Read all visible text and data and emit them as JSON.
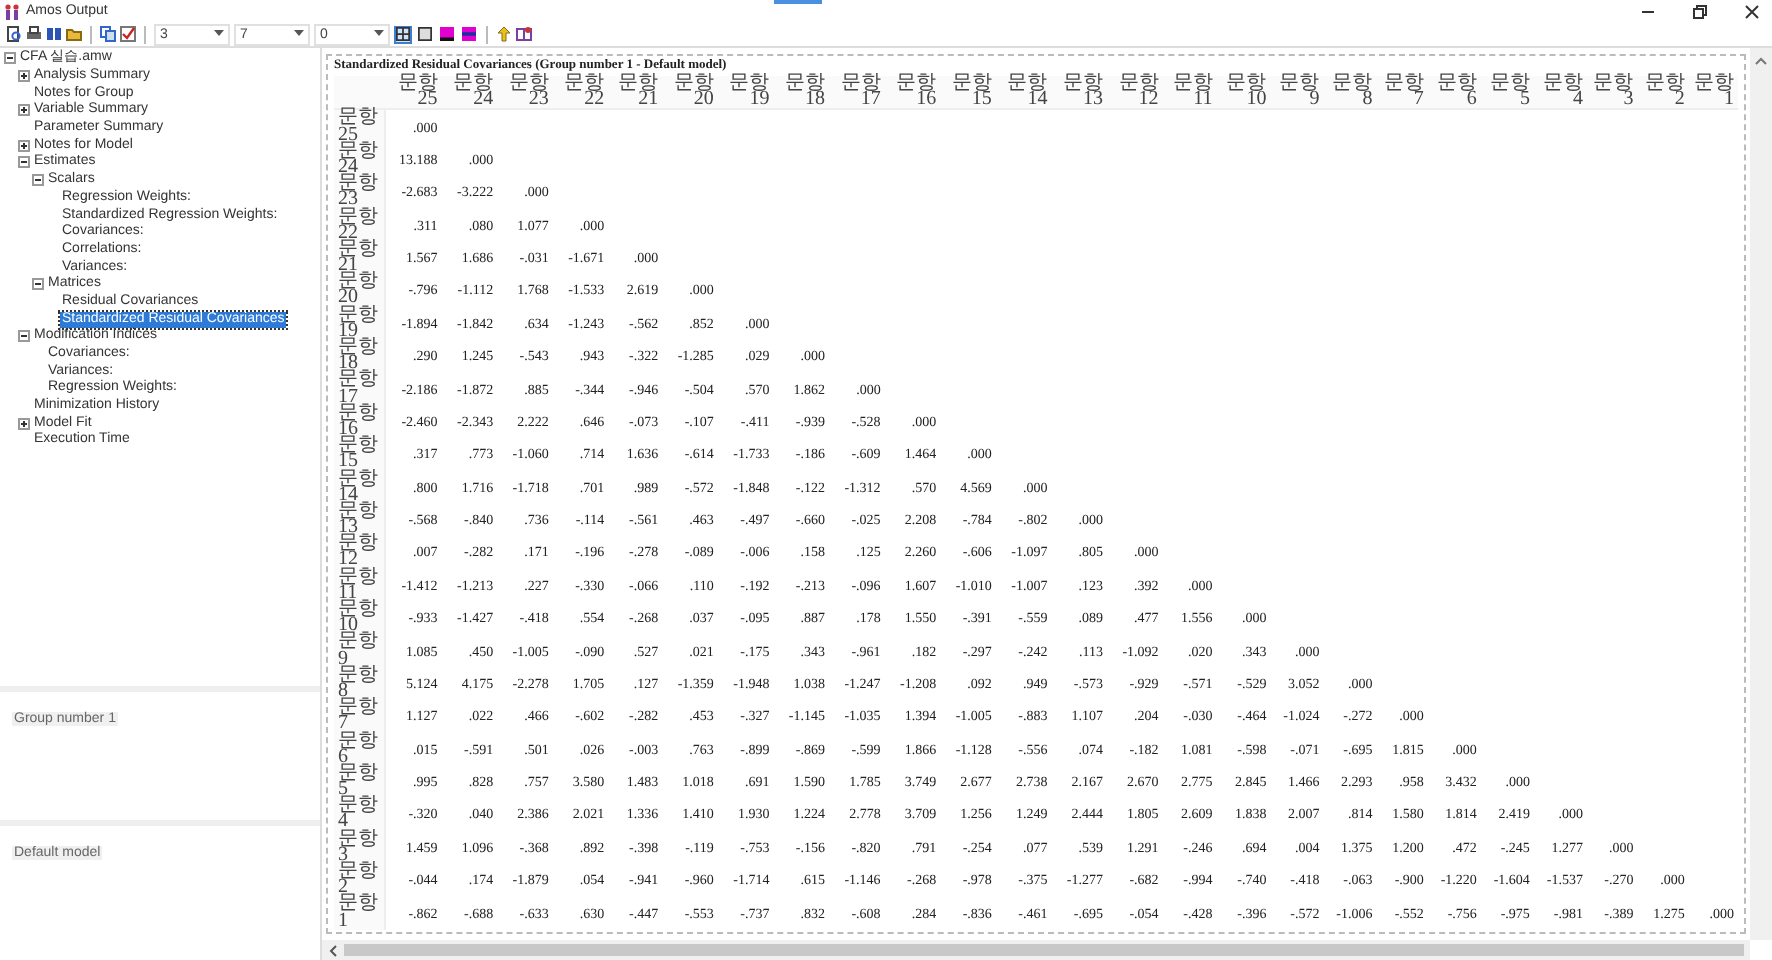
{
  "window": {
    "title": "Amos Output"
  },
  "toolbar": {
    "selectors": [
      {
        "value": "3"
      },
      {
        "value": "7"
      },
      {
        "value": "0"
      }
    ],
    "toggles": [
      {
        "kind": "grid",
        "selected": true
      },
      {
        "kind": "plain",
        "selected": false
      },
      {
        "kind": "magenta",
        "selected": false
      },
      {
        "kind": "magenta-blue",
        "selected": false
      }
    ]
  },
  "tree": {
    "items": [
      {
        "label": "CFA 실습.amw",
        "expanded": true,
        "selected": false,
        "children": [
          {
            "label": "Analysis Summary",
            "expanded": false,
            "selected": false
          },
          {
            "label": "Notes for Group",
            "selected": false
          },
          {
            "label": "Variable Summary",
            "expanded": false,
            "selected": false
          },
          {
            "label": "Parameter Summary",
            "selected": false
          },
          {
            "label": "Notes for Model",
            "expanded": false,
            "selected": false
          },
          {
            "label": "Estimates",
            "expanded": true,
            "selected": false,
            "children": [
              {
                "label": "Scalars",
                "expanded": true,
                "selected": false,
                "children": [
                  {
                    "label": "Regression Weights:",
                    "selected": false
                  },
                  {
                    "label": "Standardized Regression Weights:",
                    "selected": false
                  },
                  {
                    "label": "Covariances:",
                    "selected": false
                  },
                  {
                    "label": "Correlations:",
                    "selected": false
                  },
                  {
                    "label": "Variances:",
                    "selected": false
                  }
                ]
              },
              {
                "label": "Matrices",
                "expanded": true,
                "selected": false,
                "children": [
                  {
                    "label": "Residual Covariances",
                    "selected": false
                  },
                  {
                    "label": "Standardized Residual Covariances",
                    "selected": true
                  }
                ]
              }
            ]
          },
          {
            "label": "Modification Indices",
            "expanded": true,
            "selected": false,
            "children": [
              {
                "label": "Covariances:",
                "selected": false
              },
              {
                "label": "Variances:",
                "selected": false
              },
              {
                "label": "Regression Weights:",
                "selected": false
              }
            ]
          },
          {
            "label": "Minimization History",
            "selected": false
          },
          {
            "label": "Model Fit",
            "expanded": false,
            "selected": false
          },
          {
            "label": "Execution Time",
            "selected": false
          }
        ]
      }
    ]
  },
  "groups": {
    "items": [
      "Group number 1"
    ]
  },
  "models": {
    "items": [
      "Default model"
    ]
  },
  "output": {
    "title": "Standardized Residual Covariances (Group number 1 - Default model)",
    "columns": [
      "문항25",
      "문항24",
      "문항23",
      "문항22",
      "문항21",
      "문항20",
      "문항19",
      "문항18",
      "문항17",
      "문항16",
      "문항15",
      "문항14",
      "문항13",
      "문항12",
      "문항11",
      "문항10",
      "문항9",
      "문항8",
      "문항7",
      "문항6",
      "문항5",
      "문항4",
      "문항3",
      "문항2",
      "문항1"
    ],
    "rows": [
      {
        "label": "문항25",
        "values": [
          ".000"
        ]
      },
      {
        "label": "문항24",
        "values": [
          "13.188",
          ".000"
        ]
      },
      {
        "label": "문항23",
        "values": [
          "-2.683",
          "-3.222",
          ".000"
        ]
      },
      {
        "label": "문항22",
        "values": [
          ".311",
          ".080",
          "1.077",
          ".000"
        ]
      },
      {
        "label": "문항21",
        "values": [
          "1.567",
          "1.686",
          "-.031",
          "-1.671",
          ".000"
        ]
      },
      {
        "label": "문항20",
        "values": [
          "-.796",
          "-1.112",
          "1.768",
          "-1.533",
          "2.619",
          ".000"
        ]
      },
      {
        "label": "문항19",
        "values": [
          "-1.894",
          "-1.842",
          ".634",
          "-1.243",
          "-.562",
          ".852",
          ".000"
        ]
      },
      {
        "label": "문항18",
        "values": [
          ".290",
          "1.245",
          "-.543",
          ".943",
          "-.322",
          "-1.285",
          ".029",
          ".000"
        ]
      },
      {
        "label": "문항17",
        "values": [
          "-2.186",
          "-1.872",
          ".885",
          "-.344",
          "-.946",
          "-.504",
          ".570",
          "1.862",
          ".000"
        ]
      },
      {
        "label": "문항16",
        "values": [
          "-2.460",
          "-2.343",
          "2.222",
          ".646",
          "-.073",
          "-.107",
          "-.411",
          "-.939",
          "-.528",
          ".000"
        ]
      },
      {
        "label": "문항15",
        "values": [
          ".317",
          ".773",
          "-1.060",
          ".714",
          "1.636",
          "-.614",
          "-1.733",
          "-.186",
          "-.609",
          "1.464",
          ".000"
        ]
      },
      {
        "label": "문항14",
        "values": [
          ".800",
          "1.716",
          "-1.718",
          ".701",
          ".989",
          "-.572",
          "-1.848",
          "-.122",
          "-1.312",
          ".570",
          "4.569",
          ".000"
        ]
      },
      {
        "label": "문항13",
        "values": [
          "-.568",
          "-.840",
          ".736",
          "-.114",
          "-.561",
          ".463",
          "-.497",
          "-.660",
          "-.025",
          "2.208",
          "-.784",
          "-.802",
          ".000"
        ]
      },
      {
        "label": "문항12",
        "values": [
          ".007",
          "-.282",
          ".171",
          "-.196",
          "-.278",
          "-.089",
          "-.006",
          ".158",
          ".125",
          "2.260",
          "-.606",
          "-1.097",
          ".805",
          ".000"
        ]
      },
      {
        "label": "문항11",
        "values": [
          "-1.412",
          "-1.213",
          ".227",
          "-.330",
          "-.066",
          ".110",
          "-.192",
          "-.213",
          "-.096",
          "1.607",
          "-1.010",
          "-1.007",
          ".123",
          ".392",
          ".000"
        ]
      },
      {
        "label": "문항10",
        "values": [
          "-.933",
          "-1.427",
          "-.418",
          ".554",
          "-.268",
          ".037",
          "-.095",
          ".887",
          ".178",
          "1.550",
          "-.391",
          "-.559",
          ".089",
          ".477",
          "1.556",
          ".000"
        ]
      },
      {
        "label": "문항9",
        "values": [
          "1.085",
          ".450",
          "-1.005",
          "-.090",
          ".527",
          ".021",
          "-.175",
          ".343",
          "-.961",
          ".182",
          "-.297",
          "-.242",
          ".113",
          "-1.092",
          ".020",
          ".343",
          ".000"
        ]
      },
      {
        "label": "문항8",
        "values": [
          "5.124",
          "4.175",
          "-2.278",
          "1.705",
          ".127",
          "-1.359",
          "-1.948",
          "1.038",
          "-1.247",
          "-1.208",
          ".092",
          ".949",
          "-.573",
          "-.929",
          "-.571",
          "-.529",
          "3.052",
          ".000"
        ]
      },
      {
        "label": "문항7",
        "values": [
          "1.127",
          ".022",
          ".466",
          "-.602",
          "-.282",
          ".453",
          "-.327",
          "-1.145",
          "-1.035",
          "1.394",
          "-1.005",
          "-.883",
          "1.107",
          ".204",
          "-.030",
          "-.464",
          "-1.024",
          "-.272",
          ".000"
        ]
      },
      {
        "label": "문항6",
        "values": [
          ".015",
          "-.591",
          ".501",
          ".026",
          "-.003",
          ".763",
          "-.899",
          "-.869",
          "-.599",
          "1.866",
          "-1.128",
          "-.556",
          ".074",
          "-.182",
          "1.081",
          "-.598",
          "-.071",
          "-.695",
          "1.815",
          ".000"
        ]
      },
      {
        "label": "문항5",
        "values": [
          ".995",
          ".828",
          ".757",
          "3.580",
          "1.483",
          "1.018",
          ".691",
          "1.590",
          "1.785",
          "3.749",
          "2.677",
          "2.738",
          "2.167",
          "2.670",
          "2.775",
          "2.845",
          "1.466",
          "2.293",
          ".958",
          "3.432",
          ".000"
        ]
      },
      {
        "label": "문항4",
        "values": [
          "-.320",
          ".040",
          "2.386",
          "2.021",
          "1.336",
          "1.410",
          "1.930",
          "1.224",
          "2.778",
          "3.709",
          "1.256",
          "1.249",
          "2.444",
          "1.805",
          "2.609",
          "1.838",
          "2.007",
          ".814",
          "1.580",
          "1.814",
          "2.419",
          ".000"
        ]
      },
      {
        "label": "문항3",
        "values": [
          "1.459",
          "1.096",
          "-.368",
          ".892",
          "-.398",
          "-.119",
          "-.753",
          "-.156",
          "-.820",
          ".791",
          "-.254",
          ".077",
          ".539",
          "1.291",
          "-.246",
          ".694",
          ".004",
          "1.375",
          "1.200",
          ".472",
          "-.245",
          "1.277",
          ".000"
        ]
      },
      {
        "label": "문항2",
        "values": [
          "-.044",
          ".174",
          "-1.879",
          ".054",
          "-.941",
          "-.960",
          "-1.714",
          ".615",
          "-1.146",
          "-.268",
          "-.978",
          "-.375",
          "-1.277",
          "-.682",
          "-.994",
          "-.740",
          "-.418",
          "-.063",
          "-.900",
          "-1.220",
          "-1.604",
          "-1.537",
          "-.270",
          ".000"
        ]
      },
      {
        "label": "문항1",
        "values": [
          "-.862",
          "-.688",
          "-.633",
          ".630",
          "-.447",
          "-.553",
          "-.737",
          ".832",
          "-.608",
          ".284",
          "-.836",
          "-.461",
          "-.695",
          "-.054",
          "-.428",
          "-.396",
          "-.572",
          "-1.006",
          "-.552",
          "-.756",
          "-.975",
          "-.981",
          "-.389",
          "1.275",
          ".000"
        ]
      }
    ]
  }
}
